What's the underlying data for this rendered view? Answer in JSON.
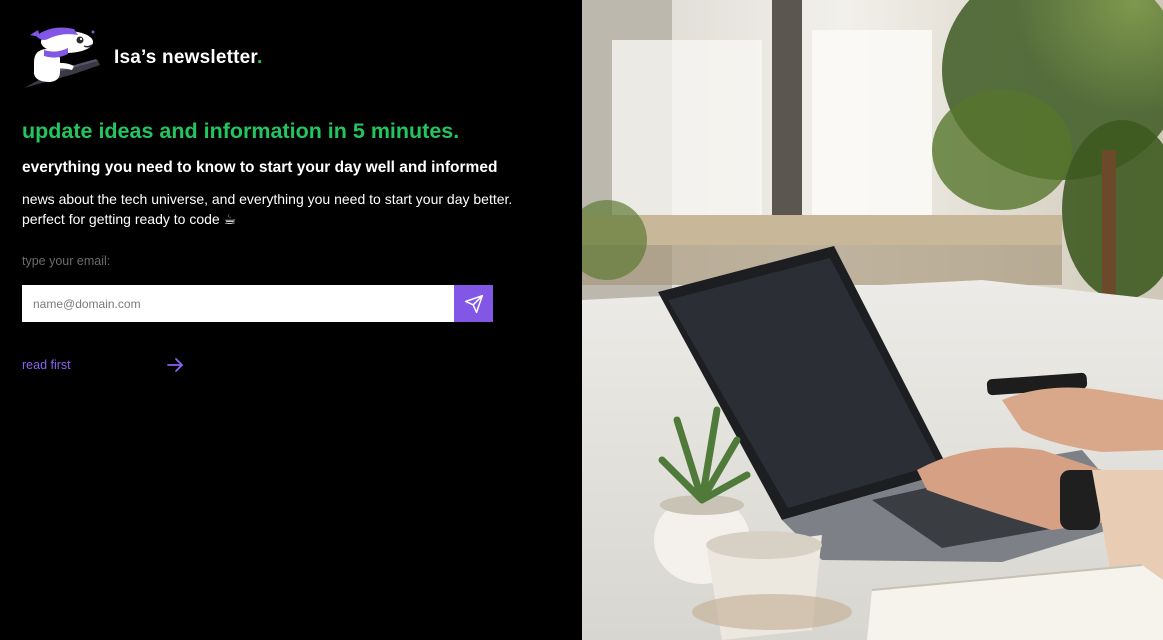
{
  "brand": {
    "logo_icon": "mascot-at-laptop-icon",
    "name": "Isa’s newsletter",
    "dot": "."
  },
  "hero": {
    "headline": "update ideas and information in 5 minutes.",
    "subheadline": "everything you need to know to start your day well and informed",
    "description_line1": "news about the tech universe, and everything you need to start your day better.",
    "description_line2": "perfect for getting ready to code ☕"
  },
  "form": {
    "label": "type your email:",
    "placeholder": "name@domain.com",
    "submit_icon": "paper-plane-icon"
  },
  "links": {
    "read_first_label": "read first",
    "read_first_icon": "arrow-right-icon"
  },
  "colors": {
    "background": "#000000",
    "accent_green": "#22c55e",
    "accent_purple": "#8257e5",
    "link_purple": "#8b63f0"
  },
  "hero_image": {
    "icon": "laptop-workspace-photo"
  }
}
